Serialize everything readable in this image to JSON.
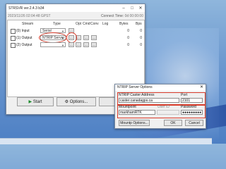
{
  "main": {
    "title": "STRSVR ver.2.4.3 b34",
    "timestamp": "2023/11/26 02:04:48 GPST",
    "connect_time_label": "Connect Time:",
    "connect_time": "0d 00:00:00",
    "headers": {
      "stream": "Stream",
      "type": "Type",
      "opt": "Opt",
      "cmd": "Cmd",
      "conv": "Conv",
      "log": "Log",
      "bytes": "Bytes",
      "bps": "Bps"
    },
    "rows": [
      {
        "label": "(0) Input",
        "type": "Serial",
        "opt": "...",
        "cmd": "",
        "conv": "",
        "log": "",
        "bytes": "0",
        "bps": "0"
      },
      {
        "label": "(1) Output",
        "type": "NTRIP Server",
        "opt": "...",
        "cmd": "...",
        "conv": "...",
        "log": "...",
        "bytes": "0",
        "bps": "0"
      },
      {
        "label": "(2) Output",
        "type": "",
        "opt": "...",
        "cmd": "...",
        "conv": "...",
        "log": "...",
        "bytes": "0",
        "bps": "0"
      }
    ],
    "buttons": {
      "start": "Start",
      "options": "Options...",
      "exit": "Exit"
    }
  },
  "dialog": {
    "title": "NTRIP Server Options",
    "caster_label": "NTRIP Caster Address",
    "port_label": "Port",
    "caster_value": "caster.canadagps.ca",
    "port_value": "2101",
    "mountpoint_label": "Mountpoint",
    "userid_label": "User ID",
    "password_label": "Password",
    "mountpoint_value": "markhamRTK",
    "password_value": "●●●●●●●●●",
    "mntp_button": "Mountp Options...",
    "ok_button": "OK",
    "cancel_button": "Cancel"
  },
  "colors": {
    "highlight": "#d83b2a",
    "desktop": "#6f9bd0"
  }
}
